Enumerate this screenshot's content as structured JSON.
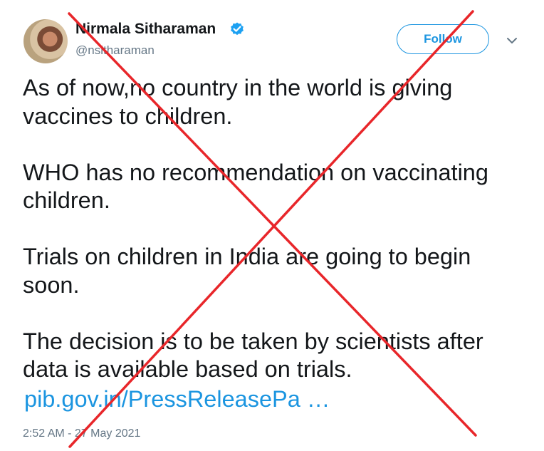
{
  "tweet": {
    "author_name": "Nirmala Sitharaman",
    "handle": "@nsitharaman",
    "verified_icon": "verified-badge-icon",
    "follow_label": "Follow",
    "menu_icon": "chevron-down-icon",
    "paragraphs": [
      "As of now,no country in the world is giving vaccines to children.",
      "WHO has no recommendation on vaccinating children.",
      "Trials on children in India are going to begin soon.",
      "The decision is to be taken by scientists after data is available based on trials."
    ],
    "link_text": "pib.gov.in/PressReleasePa …",
    "timestamp": "2:52 AM - 27 May 2021"
  },
  "colors": {
    "link": "#1b95e0",
    "muted": "#657786",
    "cross_mark": "#e8262a"
  }
}
